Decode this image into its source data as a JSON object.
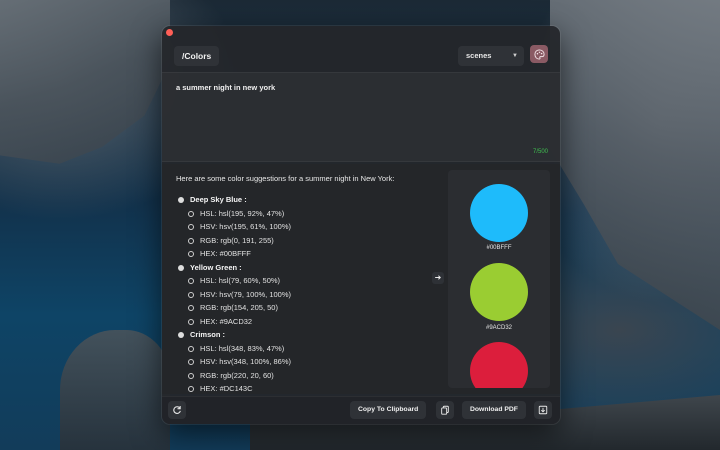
{
  "header": {
    "command_label": "/Colors",
    "select_value": "scenes"
  },
  "prompt": {
    "text": "a summer night in new york",
    "counter": "7/500"
  },
  "result": {
    "intro": "Here are some color suggestions for a summer night in New York:",
    "colors": [
      {
        "name": "Deep Sky Blue :",
        "hsl": "HSL: hsl(195, 92%, 47%)",
        "hsv": "HSV: hsv(195, 61%, 100%)",
        "rgb": "RGB: rgb(0, 191, 255)",
        "hex": "HEX: #00BFFF",
        "swatch_label": "#00BFFF",
        "swatch_color": "#1EBBFB"
      },
      {
        "name": "Yellow Green :",
        "hsl": "HSL: hsl(79, 60%, 50%)",
        "hsv": "HSV: hsv(79, 100%, 100%)",
        "rgb": "RGB: rgb(154, 205, 50)",
        "hex": "HEX: #9ACD32",
        "swatch_label": "#9ACD32",
        "swatch_color": "#9ACD32"
      },
      {
        "name": "Crimson :",
        "hsl": "HSL: hsl(348, 83%, 47%)",
        "hsv": "HSV: hsv(348, 100%, 86%)",
        "rgb": "RGB: rgb(220, 20, 60)",
        "hex": "HEX: #DC143C",
        "swatch_label": "",
        "swatch_color": "#DC1E3C"
      }
    ]
  },
  "footer": {
    "copy_label": "Copy To Clipboard",
    "download_label": "Download PDF"
  }
}
